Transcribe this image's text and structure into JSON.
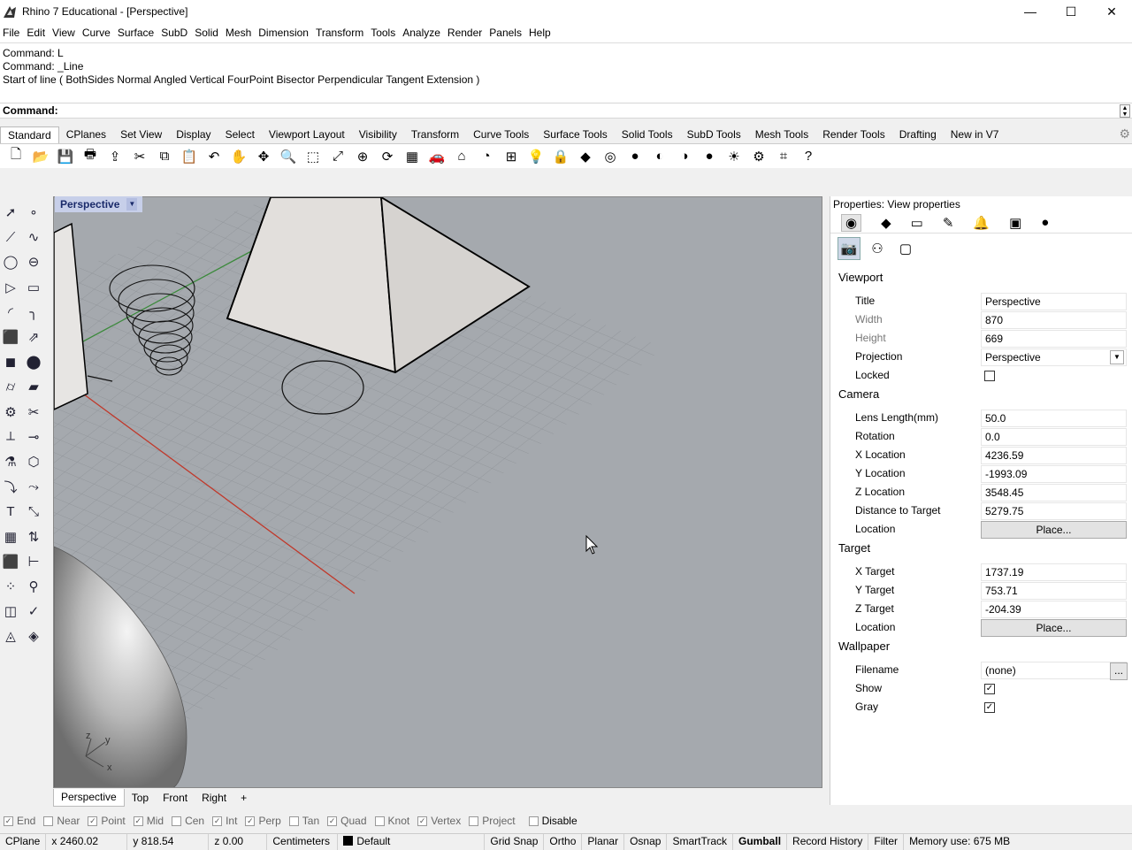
{
  "window": {
    "title": "Rhino 7 Educational - [Perspective]",
    "minimize": "—",
    "maximize": "☐",
    "close": "✕"
  },
  "menu": [
    "File",
    "Edit",
    "View",
    "Curve",
    "Surface",
    "SubD",
    "Solid",
    "Mesh",
    "Dimension",
    "Transform",
    "Tools",
    "Analyze",
    "Render",
    "Panels",
    "Help"
  ],
  "command_history": [
    "Command: L",
    "Command: _Line",
    "Start of line ( BothSides  Normal  Angled  Vertical  FourPoint  Bisector  Perpendicular  Tangent  Extension )"
  ],
  "command_prompt": "Command:",
  "toolbar_tabs": [
    "Standard",
    "CPlanes",
    "Set View",
    "Display",
    "Select",
    "Viewport Layout",
    "Visibility",
    "Transform",
    "Curve Tools",
    "Surface Tools",
    "Solid Tools",
    "SubD Tools",
    "Mesh Tools",
    "Render Tools",
    "Drafting",
    "New in V7"
  ],
  "active_toolbar_tab": "Standard",
  "toolbar_icons": [
    "new-icon",
    "open-icon",
    "save-icon",
    "print-icon",
    "import-icon",
    "cut-icon",
    "copy-icon",
    "paste-icon",
    "undo-icon",
    "pan-icon",
    "rotate-view-icon",
    "zoom-icon",
    "zoom-window-icon",
    "zoom-extents-icon",
    "zoom-selected-icon",
    "rotate-camera-icon",
    "viewport-layout-icon",
    "car-icon",
    "perspective-icon",
    "cplane-icon",
    "grid-icon",
    "light-icon",
    "lock-icon",
    "layer-icon",
    "color-icon",
    "shaded-icon",
    "rendered-icon",
    "material-icon",
    "render-sphere-icon",
    "options-icon",
    "osnap-icon",
    "settings-icon",
    "help-icon"
  ],
  "viewport": {
    "name": "Perspective",
    "axis_z": "z",
    "axis_y": "y",
    "axis_x": "x"
  },
  "viewport_tabs": [
    "Perspective",
    "Top",
    "Front",
    "Right",
    "+"
  ],
  "panel": {
    "title": "Properties: View properties",
    "sections": {
      "viewport": "Viewport",
      "camera": "Camera",
      "target": "Target",
      "wallpaper": "Wallpaper"
    },
    "viewport_rows": [
      {
        "label": "Title",
        "value": "Perspective"
      },
      {
        "label": "Width",
        "value": "870"
      },
      {
        "label": "Height",
        "value": "669"
      },
      {
        "label": "Projection",
        "value": "Perspective"
      },
      {
        "label": "Locked",
        "value": ""
      }
    ],
    "camera_rows": [
      {
        "label": "Lens Length(mm)",
        "value": "50.0"
      },
      {
        "label": "Rotation",
        "value": "0.0"
      },
      {
        "label": "X Location",
        "value": "4236.59"
      },
      {
        "label": "Y Location",
        "value": "-1993.09"
      },
      {
        "label": "Z Location",
        "value": "3548.45"
      },
      {
        "label": "Distance to Target",
        "value": "5279.75"
      },
      {
        "label": "Location",
        "value": "Place..."
      }
    ],
    "target_rows": [
      {
        "label": "X Target",
        "value": "1737.19"
      },
      {
        "label": "Y Target",
        "value": "753.71"
      },
      {
        "label": "Z Target",
        "value": "-204.39"
      },
      {
        "label": "Location",
        "value": "Place..."
      }
    ],
    "wallpaper_rows": [
      {
        "label": "Filename",
        "value": "(none)"
      },
      {
        "label": "Show",
        "value": "✓"
      },
      {
        "label": "Gray",
        "value": "✓"
      }
    ],
    "ellipsis": "..."
  },
  "osnaps": [
    {
      "label": "End",
      "checked": true
    },
    {
      "label": "Near",
      "checked": false
    },
    {
      "label": "Point",
      "checked": true
    },
    {
      "label": "Mid",
      "checked": true
    },
    {
      "label": "Cen",
      "checked": false
    },
    {
      "label": "Int",
      "checked": true
    },
    {
      "label": "Perp",
      "checked": true
    },
    {
      "label": "Tan",
      "checked": false
    },
    {
      "label": "Quad",
      "checked": true
    },
    {
      "label": "Knot",
      "checked": false
    },
    {
      "label": "Vertex",
      "checked": true
    },
    {
      "label": "Project",
      "checked": false
    },
    {
      "label": "Disable",
      "checked": false
    }
  ],
  "status": {
    "cplane": "CPlane",
    "x": "x 2460.02",
    "y": "y 818.54",
    "z": "z 0.00",
    "units": "Centimeters",
    "layer": "Default",
    "toggles": [
      "Grid Snap",
      "Ortho",
      "Planar",
      "Osnap",
      "SmartTrack",
      "Gumball",
      "Record History",
      "Filter"
    ],
    "active_toggle": "Gumball",
    "memory": "Memory use: 675 MB"
  },
  "colors": {
    "viewport_bg": "#a5a9ae",
    "x_axis": "#c0392b",
    "y_axis": "#3c8a3c",
    "viewport_title_bg": "#c7cfe9"
  }
}
